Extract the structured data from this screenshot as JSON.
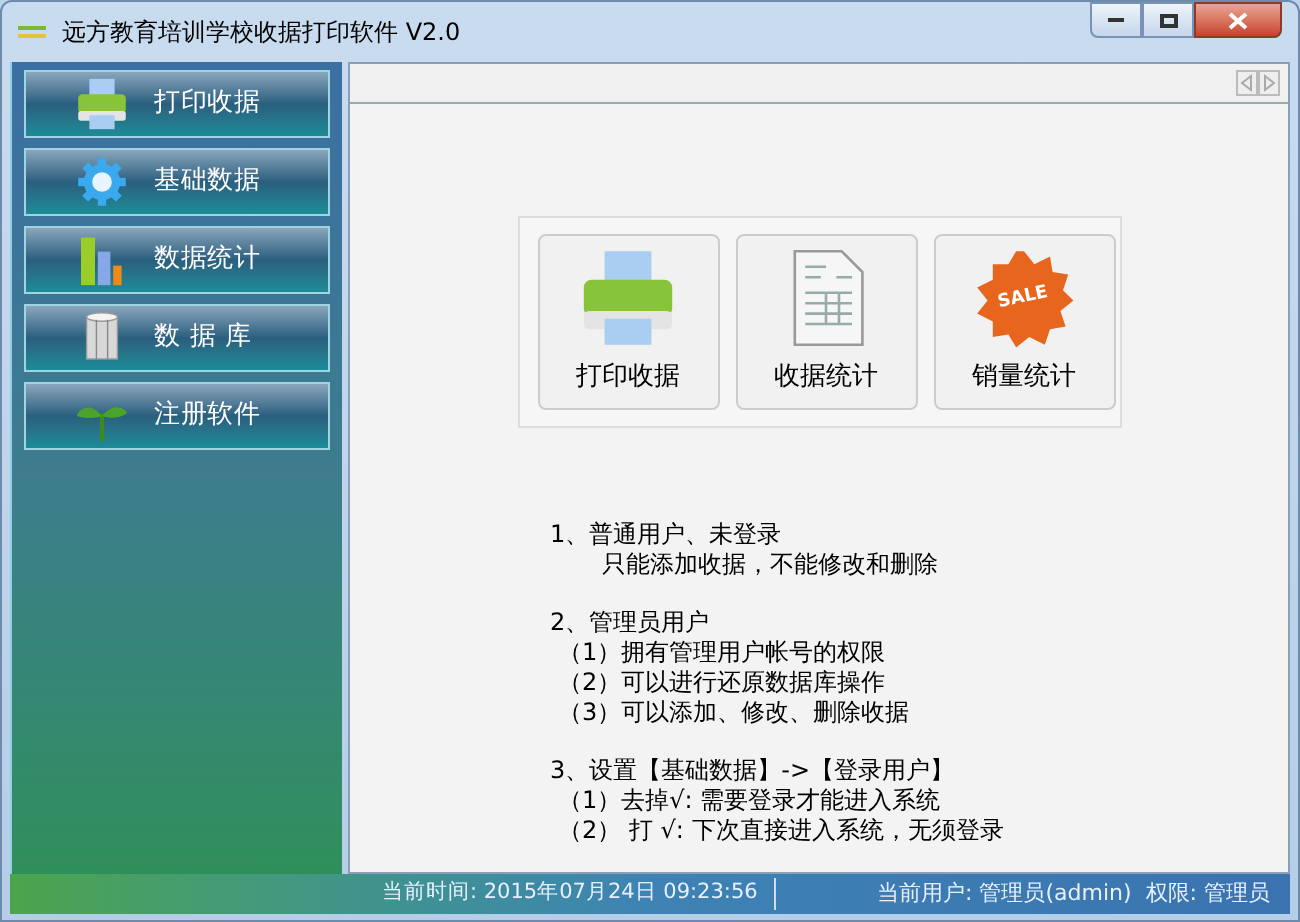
{
  "window": {
    "title": "远方教育培训学校收据打印软件 V2.0"
  },
  "sidebar": {
    "items": [
      {
        "label": "打印收据"
      },
      {
        "label": "基础数据"
      },
      {
        "label": "数据统计"
      },
      {
        "label": "数 据 库"
      },
      {
        "label": "注册软件"
      }
    ]
  },
  "shortcuts": [
    {
      "label": "打印收据"
    },
    {
      "label": "收据统计"
    },
    {
      "label": "销量统计",
      "badge": "SALE"
    }
  ],
  "instructions": [
    {
      "heading": "1、普通用户、未登录",
      "lines": [
        "只能添加收据，不能修改和删除"
      ]
    },
    {
      "heading": "2、管理员用户",
      "lines": [
        "（1）拥有管理用户帐号的权限",
        "（2）可以进行还原数据库操作",
        "（3）可以添加、修改、删除收据"
      ]
    },
    {
      "heading": "3、设置【基础数据】->【登录用户】",
      "lines": [
        "（1）去掉√: 需要登录才能进入系统",
        "（2） 打 √: 下次直接进入系统，无须登录"
      ]
    }
  ],
  "status_bar": {
    "time": "当前时间: 2015年07月24日 09:23:56",
    "user": "当前用户: 管理员(admin)  权限: 管理员"
  }
}
